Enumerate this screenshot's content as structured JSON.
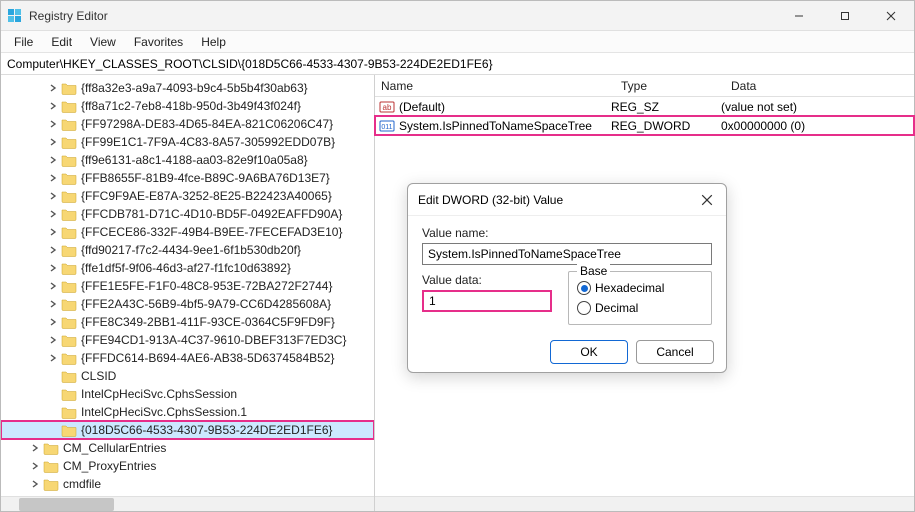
{
  "title": "Registry Editor",
  "menu": {
    "file": "File",
    "edit": "Edit",
    "view": "View",
    "favorites": "Favorites",
    "help": "Help"
  },
  "address": "Computer\\HKEY_CLASSES_ROOT\\CLSID\\{018D5C66-4533-4307-9B53-224DE2ED1FE6}",
  "tree": [
    "{ff8a32e3-a9a7-4093-b9c4-5b5b4f30ab63}",
    "{ff8a71c2-7eb8-418b-950d-3b49f43f024f}",
    "{FF97298A-DE83-4D65-84EA-821C06206C47}",
    "{FF99E1C1-7F9A-4C83-8A57-305992EDD07B}",
    "{ff9e6131-a8c1-4188-aa03-82e9f10a05a8}",
    "{FFB8655F-81B9-4fce-B89C-9A6BA76D13E7}",
    "{FFC9F9AE-E87A-3252-8E25-B22423A40065}",
    "{FFCDB781-D71C-4D10-BD5F-0492EAFFD90A}",
    "{FFCECE86-332F-49B4-B9EE-7FECEFAD3E10}",
    "{ffd90217-f7c2-4434-9ee1-6f1b530db20f}",
    "{ffe1df5f-9f06-46d3-af27-f1fc10d63892}",
    "{FFE1E5FE-F1F0-48C8-953E-72BA272F2744}",
    "{FFE2A43C-56B9-4bf5-9A79-CC6D4285608A}",
    "{FFE8C349-2BB1-411F-93CE-0364C5F9FD9F}",
    "{FFE94CD1-913A-4C37-9610-DBEF313F7ED3C}",
    "{FFFDC614-B694-4AE6-AB38-5D6374584B52}",
    "CLSID",
    "IntelCpHeciSvc.CphsSession",
    "IntelCpHeciSvc.CphsSession.1",
    "{018D5C66-4533-4307-9B53-224DE2ED1FE6}",
    "CM_CellularEntries",
    "CM_ProxyEntries",
    "cmdfile"
  ],
  "treeMeta": {
    "selectedIndex": 19,
    "highlightIndex": 19,
    "noChevIndices": [
      16,
      17,
      18,
      19
    ],
    "level1StartIndex": 20
  },
  "list": {
    "cols": {
      "name": "Name",
      "type": "Type",
      "data": "Data"
    },
    "rows": [
      {
        "name": "(Default)",
        "type": "REG_SZ",
        "data": "(value not set)",
        "icon": "string",
        "hl": false
      },
      {
        "name": "System.IsPinnedToNameSpaceTree",
        "type": "REG_DWORD",
        "data": "0x00000000 (0)",
        "icon": "binary",
        "hl": true
      }
    ]
  },
  "dialog": {
    "title": "Edit DWORD (32-bit) Value",
    "valueNameLabel": "Value name:",
    "valueName": "System.IsPinnedToNameSpaceTree",
    "valueDataLabel": "Value data:",
    "valueData": "1",
    "baseLabel": "Base",
    "hex": "Hexadecimal",
    "dec": "Decimal",
    "ok": "OK",
    "cancel": "Cancel"
  }
}
